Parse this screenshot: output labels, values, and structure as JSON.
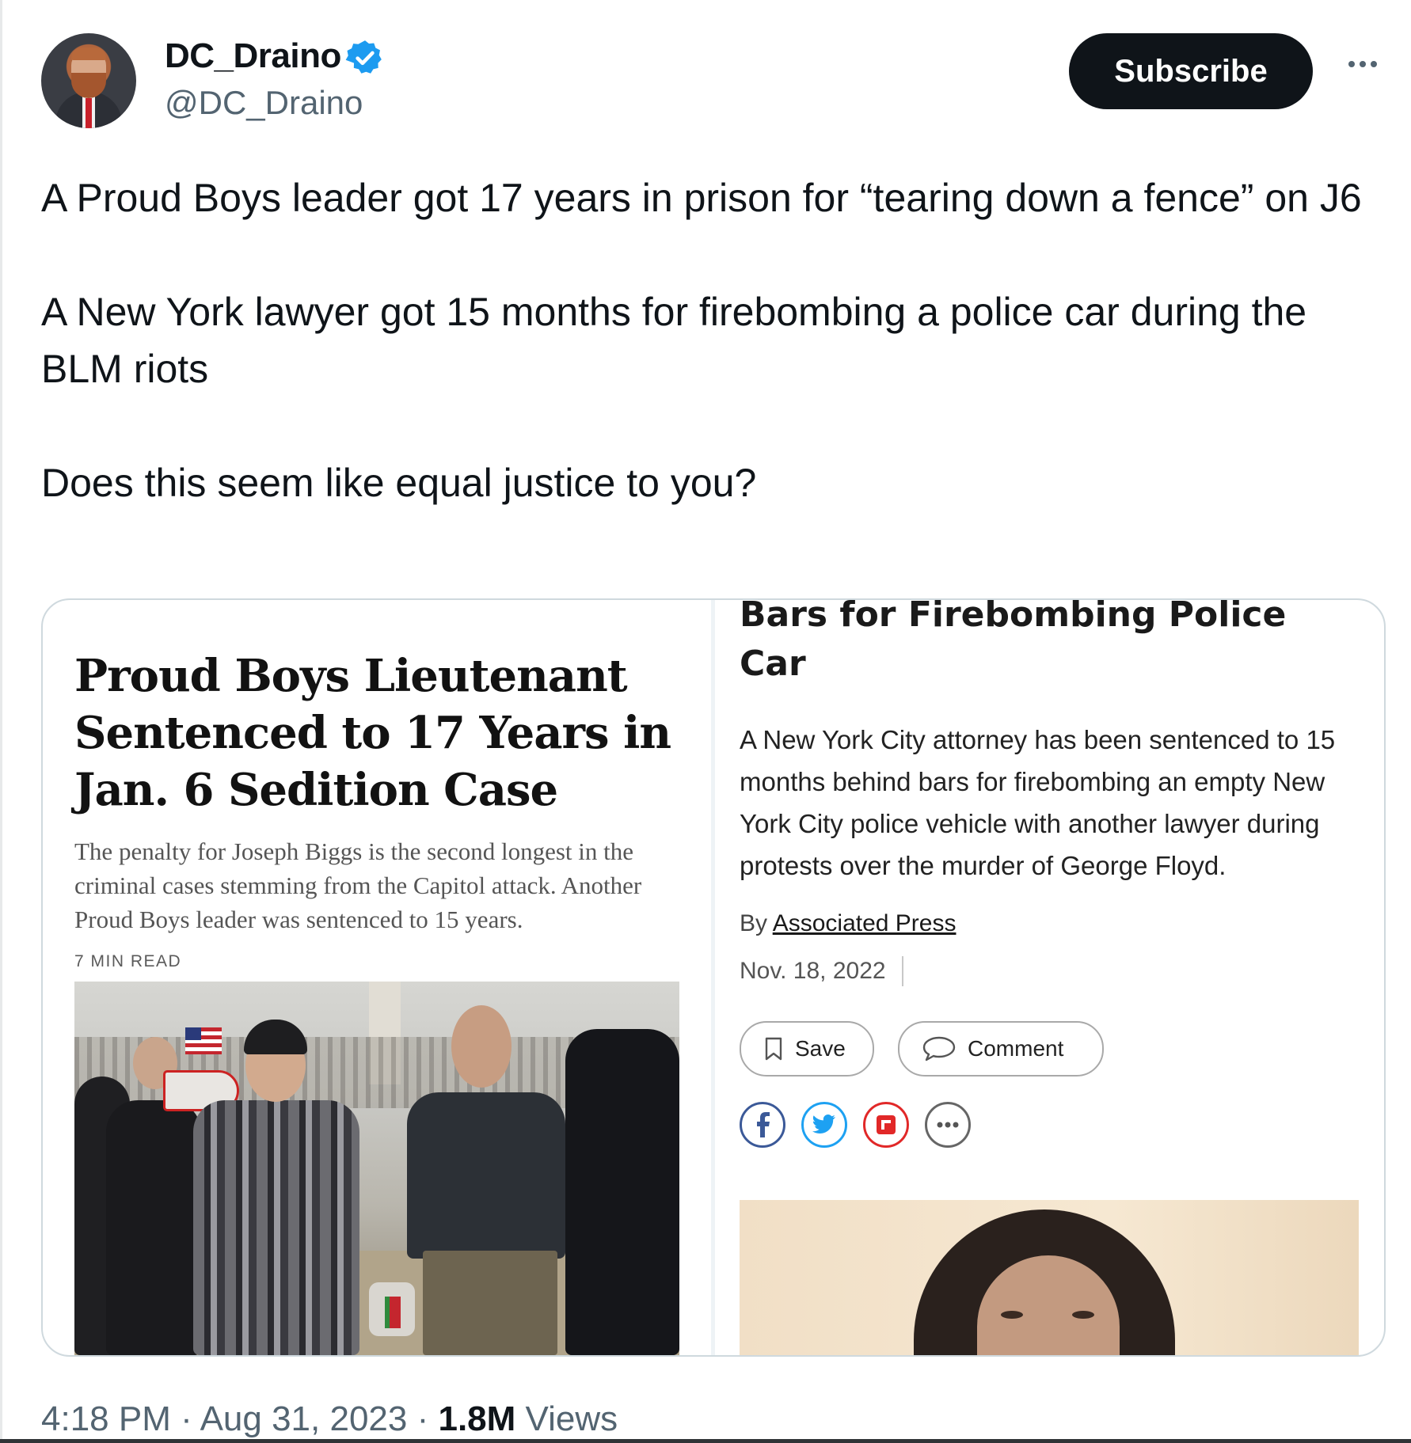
{
  "author": {
    "display_name": "DC_Draino",
    "handle": "@DC_Draino",
    "verified": true,
    "avatar_icon": "profile-photo"
  },
  "header": {
    "subscribe_label": "Subscribe",
    "more_icon": "more-horizontal-icon"
  },
  "tweet": {
    "paragraphs": [
      "A Proud Boys leader got 17 years in prison for “tearing down a fence” on J6",
      "A New York lawyer got 15 months for firebombing a police car during the BLM riots",
      "Does this seem like equal justice to you?"
    ]
  },
  "media": {
    "left": {
      "headline": "Proud Boys Lieutenant Sentenced to 17 Years in Jan. 6 Sedition Case",
      "summary": "The penalty for Joseph Biggs is the second longest in the criminal cases stemming from the Capitol attack. Another Proud Boys leader was sentenced to 15 years.",
      "read_time": "7 MIN READ",
      "photo_label": "USA"
    },
    "right": {
      "headline": "Bars for Firebombing Police Car",
      "summary": "A New York City attorney has been sentenced to 15 months behind bars for firebombing an empty New York City police vehicle with another lawyer during protests over the murder of George Floyd.",
      "byline_prefix": "By",
      "byline_author": "Associated Press",
      "date": "Nov. 18, 2022",
      "save_label": "Save",
      "comment_label": "Comment",
      "share_icons": [
        "facebook-icon",
        "twitter-icon",
        "flipboard-icon",
        "more-icon"
      ]
    }
  },
  "footer": {
    "time": "4:18 PM",
    "dot": "·",
    "date": "Aug 31, 2023",
    "views_count": "1.8M",
    "views_label": "Views"
  },
  "colors": {
    "text": "#0f1419",
    "secondary": "#536471",
    "verified": "#1d9bf0",
    "subscribe_bg": "#0f1419"
  }
}
